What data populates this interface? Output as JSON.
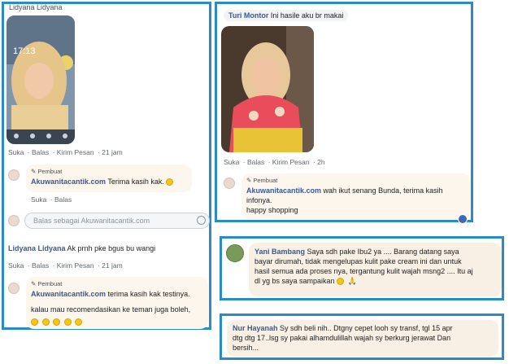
{
  "panel1": {
    "top_name": "Lidyana Lidyana",
    "phone_time": "17:13",
    "actions1": [
      "Suka",
      "Balas",
      "Kirim Pesan",
      "21 jam"
    ],
    "author_tag": "Pembuat",
    "reply1_author": "Akuwanitacantik.com",
    "reply1_text": "Terima kasih kak.",
    "reply1_emoji": "smile-emoji",
    "actions2": [
      "Suka",
      "Balas"
    ],
    "reply_placeholder": "Balas sebagai Akuwanitacantik.com",
    "comment2_name": "Lidyana Lidyana",
    "comment2_text": "Ak prnh pke bgus bu wangi",
    "actions3": [
      "Suka",
      "Balas",
      "Kirim Pesan",
      "21 jam"
    ],
    "author_tag2": "Pembuat",
    "reply2_author": "Akuwanitacantik.com",
    "reply2_text1": "terima kasih kak testinya.",
    "reply2_text2": "kalau mau recomendasikan ke teman juga boleh,",
    "reply2_emoji": "smile-emoji",
    "reply2_emoji_count": 5
  },
  "panel2": {
    "name": "Turi Montor",
    "text": "Ini hasile aku br makai",
    "actions": [
      "Suka",
      "Balas",
      "Kirim Pesan",
      "2h"
    ],
    "author_tag": "Pembuat",
    "reply_author": "Akuwanitacantik.com",
    "reply_text1": "wah ikut senang Bunda, terima kasih",
    "reply_text2": "infonya.",
    "reply_text3": "happy shopping"
  },
  "panel3": {
    "name": "Yani Bambang",
    "line1": "Saya sdh pake Ibu2 ya .... Barang datang saya",
    "line2": "bayar dirumah, tidak mengelupas kulit pake cream ini dan untuk",
    "line3": "hasil semua ada proses nya, tergantung kulit wajah msng2 .... Itu aj",
    "line4": "dl yg bs saya sampaikan",
    "line4_emojis": [
      "grin-emoji",
      "praying-hands-emoji"
    ]
  },
  "panel4": {
    "name": "Nur Hayanah",
    "line1": "Sy sdh beli nih.. Dtgny cepet looh sy transf, tgl 15 apr",
    "line2": "dtg dtg 17..lsg sy pakai alhamdulillah wajah sy berkurg jerawat Dan",
    "line3": "bersih..."
  },
  "colors": {
    "border": "#2a8cc7",
    "name_link": "#385898",
    "bubble_bg": "#fdf6ec"
  }
}
